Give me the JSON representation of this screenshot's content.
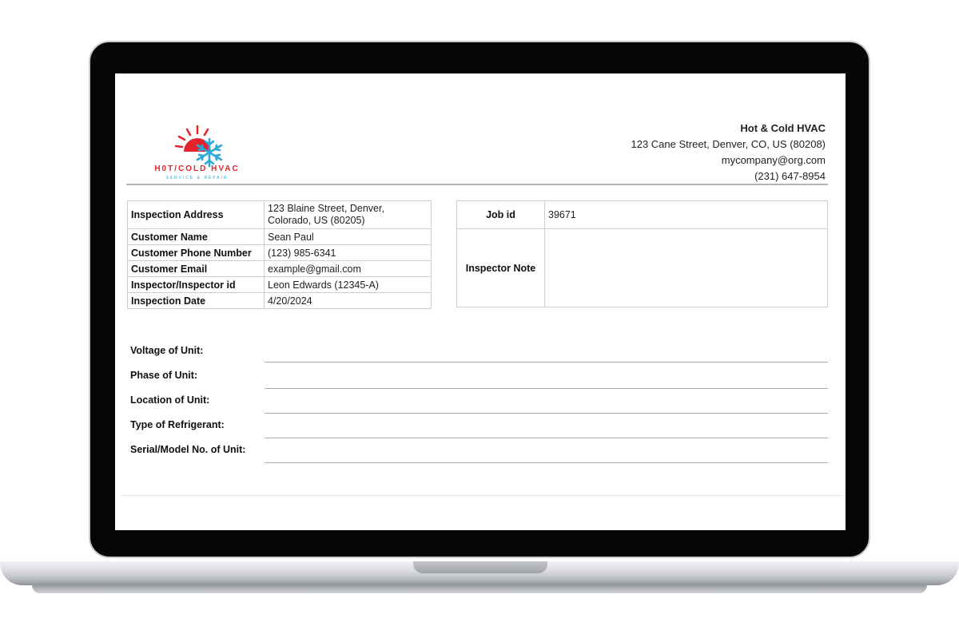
{
  "company": {
    "name": "Hot & Cold HVAC",
    "address": "123 Cane Street, Denver, CO, US (80208)",
    "email": "mycompany@org.com",
    "phone": "(231) 647-8954"
  },
  "logo": {
    "title_hot": "H0T/",
    "title_cold": "COLD HVAC",
    "subtitle": "SERVICE & REPAIR",
    "icon_names": [
      "sun-icon",
      "snowflake-icon"
    ],
    "colors": {
      "hot": "#e5232b",
      "cold": "#2aa9d8"
    }
  },
  "info": [
    {
      "label": "Inspection Address",
      "value_line1": "123 Blaine Street, Denver,",
      "value_line2": "Colorado, US (80205)"
    },
    {
      "label": "Customer Name",
      "value": "Sean Paul"
    },
    {
      "label": "Customer Phone Number",
      "value": "(123) 985-6341"
    },
    {
      "label": "Customer Email",
      "value": "example@gmail.com"
    },
    {
      "label": "Inspector/Inspector id",
      "value": "Leon Edwards (12345-A)"
    },
    {
      "label": "Inspection Date",
      "value": "4/20/2024"
    }
  ],
  "job": {
    "id_label": "Job id",
    "id_value": "39671",
    "note_label": "Inspector Note",
    "note_value": ""
  },
  "unit_fields": [
    {
      "label": "Voltage of Unit:"
    },
    {
      "label": "Phase of Unit:"
    },
    {
      "label": "Location of Unit:"
    },
    {
      "label": "Type of Refrigerant:"
    },
    {
      "label": "Serial/Model No. of Unit:"
    }
  ]
}
